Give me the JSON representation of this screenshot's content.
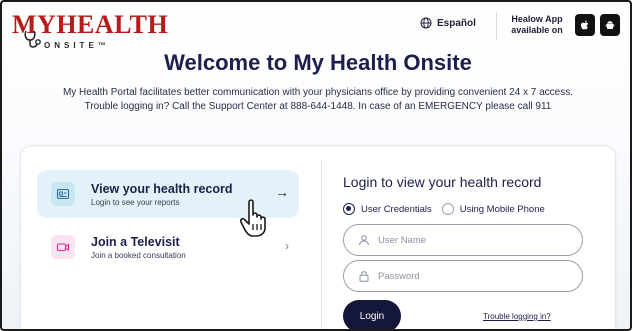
{
  "brand": {
    "logo_main": "MYHEALTH",
    "logo_sub": "ONSITE™"
  },
  "header": {
    "language_label": "Español",
    "healow_text": "Healow App available on",
    "apple_icon": "apple-icon",
    "android_icon": "android-icon"
  },
  "welcome": {
    "title": "Welcome to My Health Onsite",
    "intro": "My Health Portal facilitates better communication with your physicians office by providing convenient 24 x 7 access. Trouble logging in? Call the Support Center at 888-644-1448. In case of an EMERGENCY please call 911"
  },
  "options": [
    {
      "title": "View your health record",
      "subtitle": "Login to see your reports",
      "arrow": "→",
      "icon": "health-record-icon"
    },
    {
      "title": "Join a Televisit",
      "subtitle": "Join a booked consultation",
      "arrow": "›",
      "icon": "video-icon"
    }
  ],
  "login": {
    "title": "Login to view your health record",
    "radio_credentials": "User Credentials",
    "radio_mobile": "Using Mobile Phone",
    "username_placeholder": "User Name",
    "password_placeholder": "Password",
    "login_button": "Login",
    "trouble_link": "Trouble logging in?"
  },
  "colors": {
    "brand_red": "#b71c1c",
    "navy": "#14163a",
    "active_option_bg": "#e3f2f8"
  }
}
